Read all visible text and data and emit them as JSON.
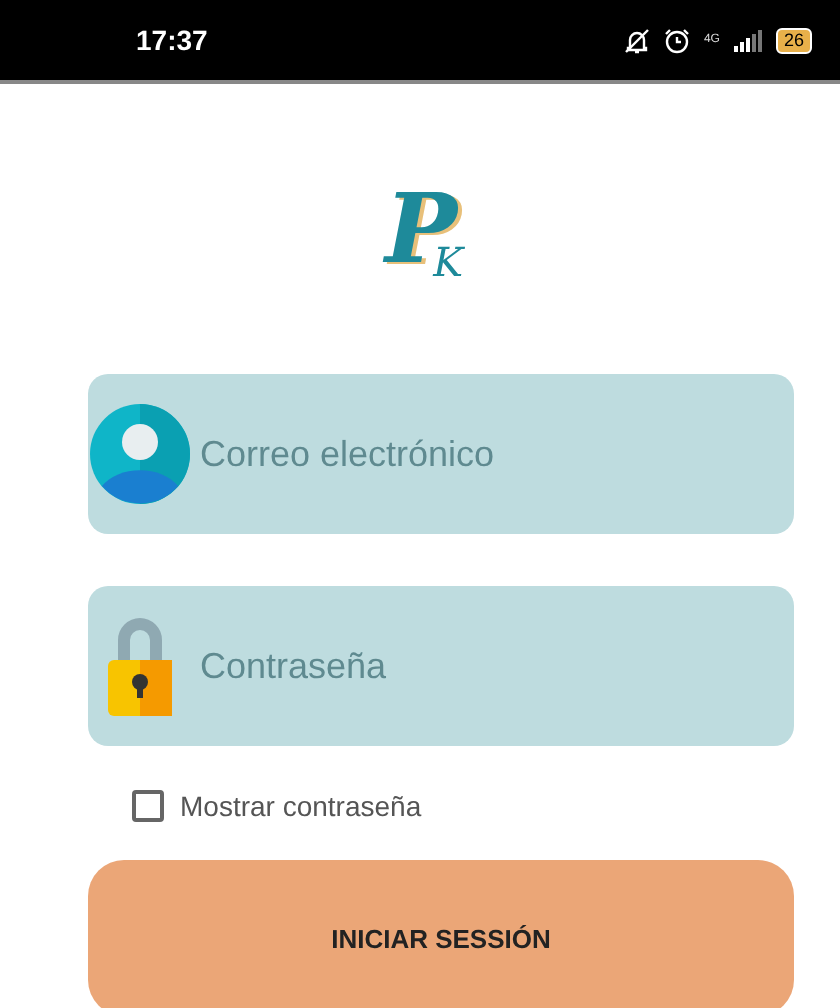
{
  "status_bar": {
    "time": "17:37",
    "network": "4G",
    "battery": "26"
  },
  "logo": {
    "letter": "P",
    "sub_letter": "K"
  },
  "fields": [
    {
      "kind": "email",
      "placeholder": "Correo electrónico"
    },
    {
      "kind": "password",
      "placeholder": "Contraseña"
    }
  ],
  "show_password": {
    "label": "Mostrar contraseña",
    "checked": false
  },
  "buttons": [
    "INICIAR SESSIÓN"
  ]
}
